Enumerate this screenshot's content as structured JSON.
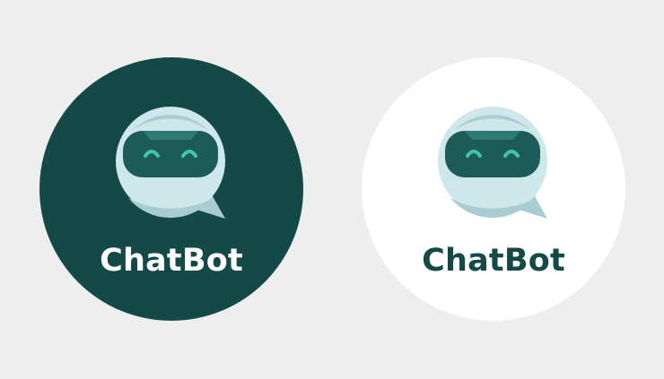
{
  "logos": [
    {
      "title": "ChatBot",
      "variant": "dark",
      "background": "#134a48",
      "text_color": "#ffffff"
    },
    {
      "title": "ChatBot",
      "variant": "light",
      "background": "#ffffff",
      "text_color": "#134a48"
    }
  ],
  "colors": {
    "page_background": "#eeeeee",
    "head": "#cde7ea",
    "head_shade": "#a9ccd3",
    "visor": "#1d5b58",
    "visor_top": "#2f7a72",
    "eyes": "#3cc9a4"
  },
  "icon": "robot-chat-bubble-icon"
}
